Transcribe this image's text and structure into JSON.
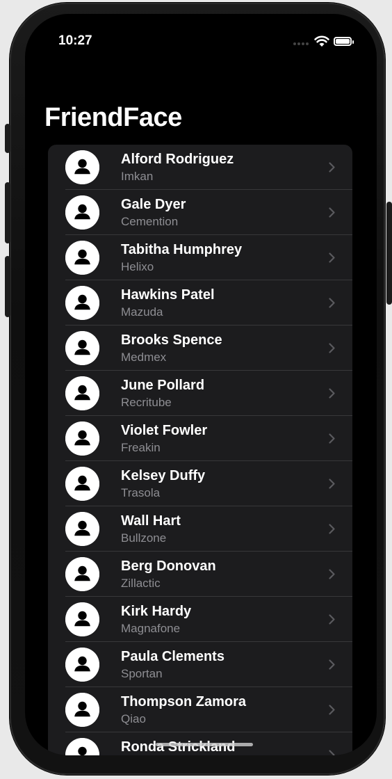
{
  "status_bar": {
    "time": "10:27"
  },
  "nav": {
    "title": "FriendFace"
  },
  "friends": [
    {
      "name": "Alford Rodriguez",
      "company": "Imkan"
    },
    {
      "name": "Gale Dyer",
      "company": "Cemention"
    },
    {
      "name": "Tabitha Humphrey",
      "company": "Helixo"
    },
    {
      "name": "Hawkins Patel",
      "company": "Mazuda"
    },
    {
      "name": "Brooks Spence",
      "company": "Medmex"
    },
    {
      "name": "June Pollard",
      "company": "Recritube"
    },
    {
      "name": "Violet Fowler",
      "company": "Freakin"
    },
    {
      "name": "Kelsey Duffy",
      "company": "Trasola"
    },
    {
      "name": "Wall Hart",
      "company": "Bullzone"
    },
    {
      "name": "Berg Donovan",
      "company": "Zillactic"
    },
    {
      "name": "Kirk Hardy",
      "company": "Magnafone"
    },
    {
      "name": "Paula Clements",
      "company": "Sportan"
    },
    {
      "name": "Thompson Zamora",
      "company": "Qiao"
    },
    {
      "name": "Ronda Strickland",
      "company": ""
    }
  ],
  "icons": {
    "avatar": "person-circle-icon",
    "disclosure": "chevron-right-icon"
  },
  "colors": {
    "background": "#000000",
    "list": "#1c1c1e",
    "secondary_text": "#8e8e93"
  }
}
